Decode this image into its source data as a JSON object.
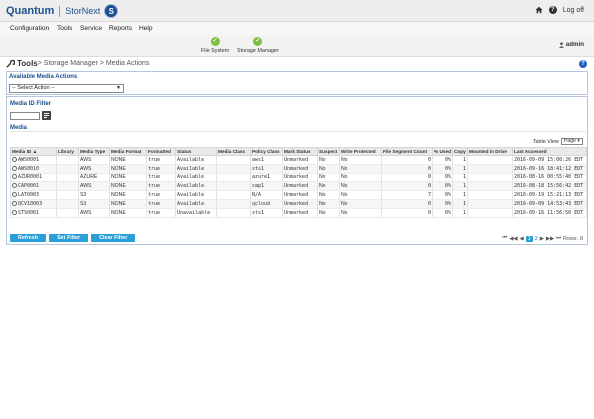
{
  "app": {
    "logo_primary": "Quantum",
    "logo_secondary": "StorNext",
    "logo_badge": "S",
    "logoff_label": "Log off"
  },
  "menu": [
    "Configuration",
    "Tools",
    "Service",
    "Reports",
    "Help"
  ],
  "status": [
    {
      "label": "File System",
      "state": "ok"
    },
    {
      "label": "Storage Manager",
      "state": "ok"
    }
  ],
  "user": {
    "name": "admin"
  },
  "breadcrumb": {
    "root": "Tools",
    "rest": " > Storage Manager > Media Actions"
  },
  "available_actions": {
    "title": "Available Media Actions",
    "selected": "-- Select Action --"
  },
  "media_filter": {
    "title": "Media ID Filter",
    "value": ""
  },
  "media_section": {
    "title": "Media"
  },
  "table_view": {
    "label": "Table View",
    "selected": "Page"
  },
  "table": {
    "columns": [
      "Media ID ▲",
      "Library",
      "Media Type",
      "Media Format",
      "Formatted",
      "Status",
      "Media Class",
      "Policy Class",
      "Mark Status",
      "Suspect",
      "Write Protected",
      "File Segment Count",
      "% Used",
      "Copy",
      "Mounted in Drive",
      "Last Accessed"
    ],
    "rows": [
      {
        "media_id": "AWS0001",
        "library": "",
        "media_type": "AWS",
        "format": "NONE",
        "formatted": "true",
        "status": "Available",
        "media_class": "",
        "policy_class": "aws1",
        "mark": "Unmarked",
        "suspect": "No",
        "write_protected": "No",
        "segments": "0",
        "used": "0%",
        "copy": "1",
        "mounted": "",
        "last_accessed": "2016-09-09 15:00:26 EDT"
      },
      {
        "media_id": "AWS0010",
        "library": "",
        "media_type": "AWS",
        "format": "NONE",
        "formatted": "true",
        "status": "Available",
        "media_class": "",
        "policy_class": "sts1",
        "mark": "Unmarked",
        "suspect": "No",
        "write_protected": "No",
        "segments": "0",
        "used": "0%",
        "copy": "1",
        "mounted": "",
        "last_accessed": "2016-09-16 18:41:12 EDT"
      },
      {
        "media_id": "AZUR0001",
        "library": "",
        "media_type": "AZURE",
        "format": "NONE",
        "formatted": "true",
        "status": "Available",
        "media_class": "",
        "policy_class": "azure1",
        "mark": "Unmarked",
        "suspect": "No",
        "write_protected": "No",
        "segments": "0",
        "used": "0%",
        "copy": "1",
        "mounted": "",
        "last_accessed": "2016-08-16 00:55:40 EDT"
      },
      {
        "media_id": "CAP0001",
        "library": "",
        "media_type": "AWS",
        "format": "NONE",
        "formatted": "true",
        "status": "Available",
        "media_class": "",
        "policy_class": "cap1",
        "mark": "Unmarked",
        "suspect": "No",
        "write_protected": "No",
        "segments": "0",
        "used": "0%",
        "copy": "1",
        "mounted": "",
        "last_accessed": "2016-08-18 15:56:42 EDT"
      },
      {
        "media_id": "LAT0003",
        "library": "",
        "media_type": "S3",
        "format": "NONE",
        "formatted": "true",
        "status": "Available",
        "media_class": "",
        "policy_class": "N/A",
        "mark": "Unmarked",
        "suspect": "No",
        "write_protected": "No",
        "segments": "7",
        "used": "0%",
        "copy": "1",
        "mounted": "",
        "last_accessed": "2016-09-19 15:21:13 EDT"
      },
      {
        "media_id": "QCV10003",
        "library": "",
        "media_type": "S3",
        "format": "NONE",
        "formatted": "true",
        "status": "Available",
        "media_class": "",
        "policy_class": "qcloud",
        "mark": "Unmarked",
        "suspect": "No",
        "write_protected": "No",
        "segments": "0",
        "used": "0%",
        "copy": "1",
        "mounted": "",
        "last_accessed": "2016-09-09 14:53:43 EDT"
      },
      {
        "media_id": "STS0001",
        "library": "",
        "media_type": "AWS",
        "format": "NONE",
        "formatted": "true",
        "status": "Unavailable",
        "media_class": "",
        "policy_class": "sts1",
        "mark": "Unmarked",
        "suspect": "No",
        "write_protected": "No",
        "segments": "0",
        "used": "0%",
        "copy": "1",
        "mounted": "",
        "last_accessed": "2016-09-16 11:56:50 EDT"
      }
    ]
  },
  "buttons": {
    "refresh": "Refresh",
    "set_filter": "Set Filter",
    "clear_filter": "Clear Filter"
  },
  "pager": {
    "first": "⏮",
    "prev_fast": "◀◀",
    "prev": "◀",
    "current": "1",
    "next_page": "2",
    "next": "▶",
    "next_fast": "▶▶",
    "last": "⏭",
    "rows_label": "Rows:",
    "rows_value": "8"
  },
  "colors": {
    "accent": "#2a9fd8",
    "brand": "#1d4f91",
    "ok": "#7fbf3f"
  },
  "icons": [
    "home-icon",
    "help-icon",
    "check-icon",
    "user-icon",
    "wrench-icon",
    "filter-icon"
  ]
}
